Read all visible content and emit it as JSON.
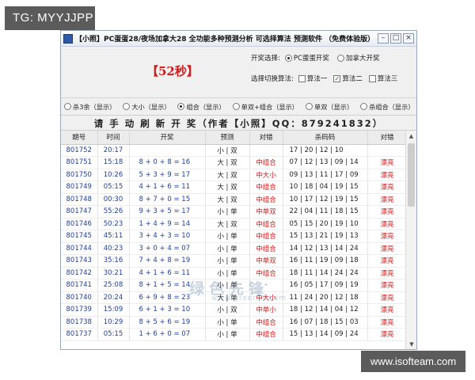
{
  "overlay": {
    "tg_label": "TG: MYYJJPP",
    "site_label": "www.isofteam.com"
  },
  "window": {
    "title": "【小照】PC蛋蛋28/夜场加拿大28 全功能多种预测分析 可选择算法 预测软件 （免费体验版）",
    "buttons": [
      "–",
      "□",
      "×"
    ]
  },
  "countdown": "【52秒】",
  "lottery_select": {
    "label": "开奖选择:",
    "options": [
      {
        "label": "PC蛋蛋开奖",
        "selected": true
      },
      {
        "label": "加拿大开奖",
        "selected": false
      }
    ]
  },
  "algorithm_select": {
    "label": "选择切换算法:",
    "options": [
      {
        "label": "算法一",
        "checked": false
      },
      {
        "label": "算法二",
        "checked": true
      },
      {
        "label": "算法三",
        "checked": false
      }
    ]
  },
  "display_options": [
    {
      "label": "杀3余（显示）",
      "selected": false
    },
    {
      "label": "大小（显示）",
      "selected": false
    },
    {
      "label": "组合（显示）",
      "selected": true
    },
    {
      "label": "单双+组合（显示）",
      "selected": false
    },
    {
      "label": "单双（显示）",
      "selected": false
    },
    {
      "label": "杀组合（显示）",
      "selected": false
    }
  ],
  "banner": "请 手 动 刷 新 开 奖（作者【小照】QQ：879241832）",
  "table": {
    "headers": [
      "期号",
      "时间",
      "开奖",
      "预测",
      "对错",
      "杀码码",
      "对错"
    ],
    "rows": [
      [
        "801752",
        "20:17",
        "",
        "小 | 双",
        "",
        "17 | 20 | 12 | 10",
        ""
      ],
      [
        "801751",
        "15:18",
        "8 + 0 + 8 = 16",
        "大 | 双",
        "中组合",
        "07 | 12 | 13 | 09 | 14",
        "漂亮"
      ],
      [
        "801750",
        "10:26",
        "5 + 3 + 9 = 17",
        "大 | 双",
        "中大小",
        "09 | 13 | 11 | 17 | 09",
        "漂亮"
      ],
      [
        "801749",
        "05:15",
        "4 + 1 + 6 = 11",
        "大 | 双",
        "中组合",
        "10 | 18 | 04 | 19 | 15",
        "漂亮"
      ],
      [
        "801748",
        "00:30",
        "8 + 7 + 0 = 15",
        "大 | 双",
        "中组合",
        "10 | 17 | 12 | 19 | 15",
        "漂亮"
      ],
      [
        "801747",
        "55:26",
        "9 + 3 + 5 = 17",
        "小 | 单",
        "中单双",
        "22 | 04 | 11 | 18 | 15",
        "漂亮"
      ],
      [
        "801746",
        "50:23",
        "1 + 4 + 9 = 14",
        "大 | 双",
        "中组合",
        "05 | 15 | 20 | 19 | 10",
        "漂亮"
      ],
      [
        "801745",
        "45:11",
        "3 + 4 + 3 = 10",
        "小 | 单",
        "中组合",
        "15 | 13 | 21 | 19 | 13",
        "漂亮"
      ],
      [
        "801744",
        "40:23",
        "3 + 0 + 4 = 07",
        "小 | 单",
        "中组合",
        "14 | 12 | 13 | 14 | 24",
        "漂亮"
      ],
      [
        "801743",
        "35:16",
        "7 + 4 + 8 = 19",
        "小 | 单",
        "中单双",
        "16 | 11 | 19 | 09 | 18",
        "漂亮"
      ],
      [
        "801742",
        "30:21",
        "4 + 1 + 6 = 11",
        "小 | 单",
        "中组合",
        "18 | 11 | 14 | 24 | 24",
        "漂亮"
      ],
      [
        "801741",
        "25:08",
        "8 + 1 + 5 = 14",
        "小 | 单",
        "-",
        "16 | 05 | 17 | 09 | 19",
        "漂亮"
      ],
      [
        "801740",
        "20:24",
        "6 + 9 + 8 = 23",
        "大 | 单",
        "中大小",
        "11 | 24 | 20 | 12 | 18",
        "漂亮"
      ],
      [
        "801739",
        "15:09",
        "6 + 1 + 3 = 10",
        "小 | 双",
        "中单小",
        "18 | 12 | 14 | 04 | 12",
        "漂亮"
      ],
      [
        "801738",
        "10:29",
        "8 + 5 + 6 = 19",
        "小 | 单",
        "中组合",
        "16 | 07 | 18 | 15 | 03",
        "漂亮"
      ],
      [
        "801737",
        "05:15",
        "1 + 6 + 0 = 07",
        "小 | 单",
        "中组合",
        "15 | 13 | 14 | 09 | 24",
        "漂亮"
      ]
    ]
  },
  "watermark": {
    "text": "绿色先锋",
    "url": "www.greenxf.com"
  },
  "colors": {
    "accent_red": "#d11a1a",
    "link_blue": "#1f3f9a",
    "window_bg": "#f0f0f0"
  }
}
